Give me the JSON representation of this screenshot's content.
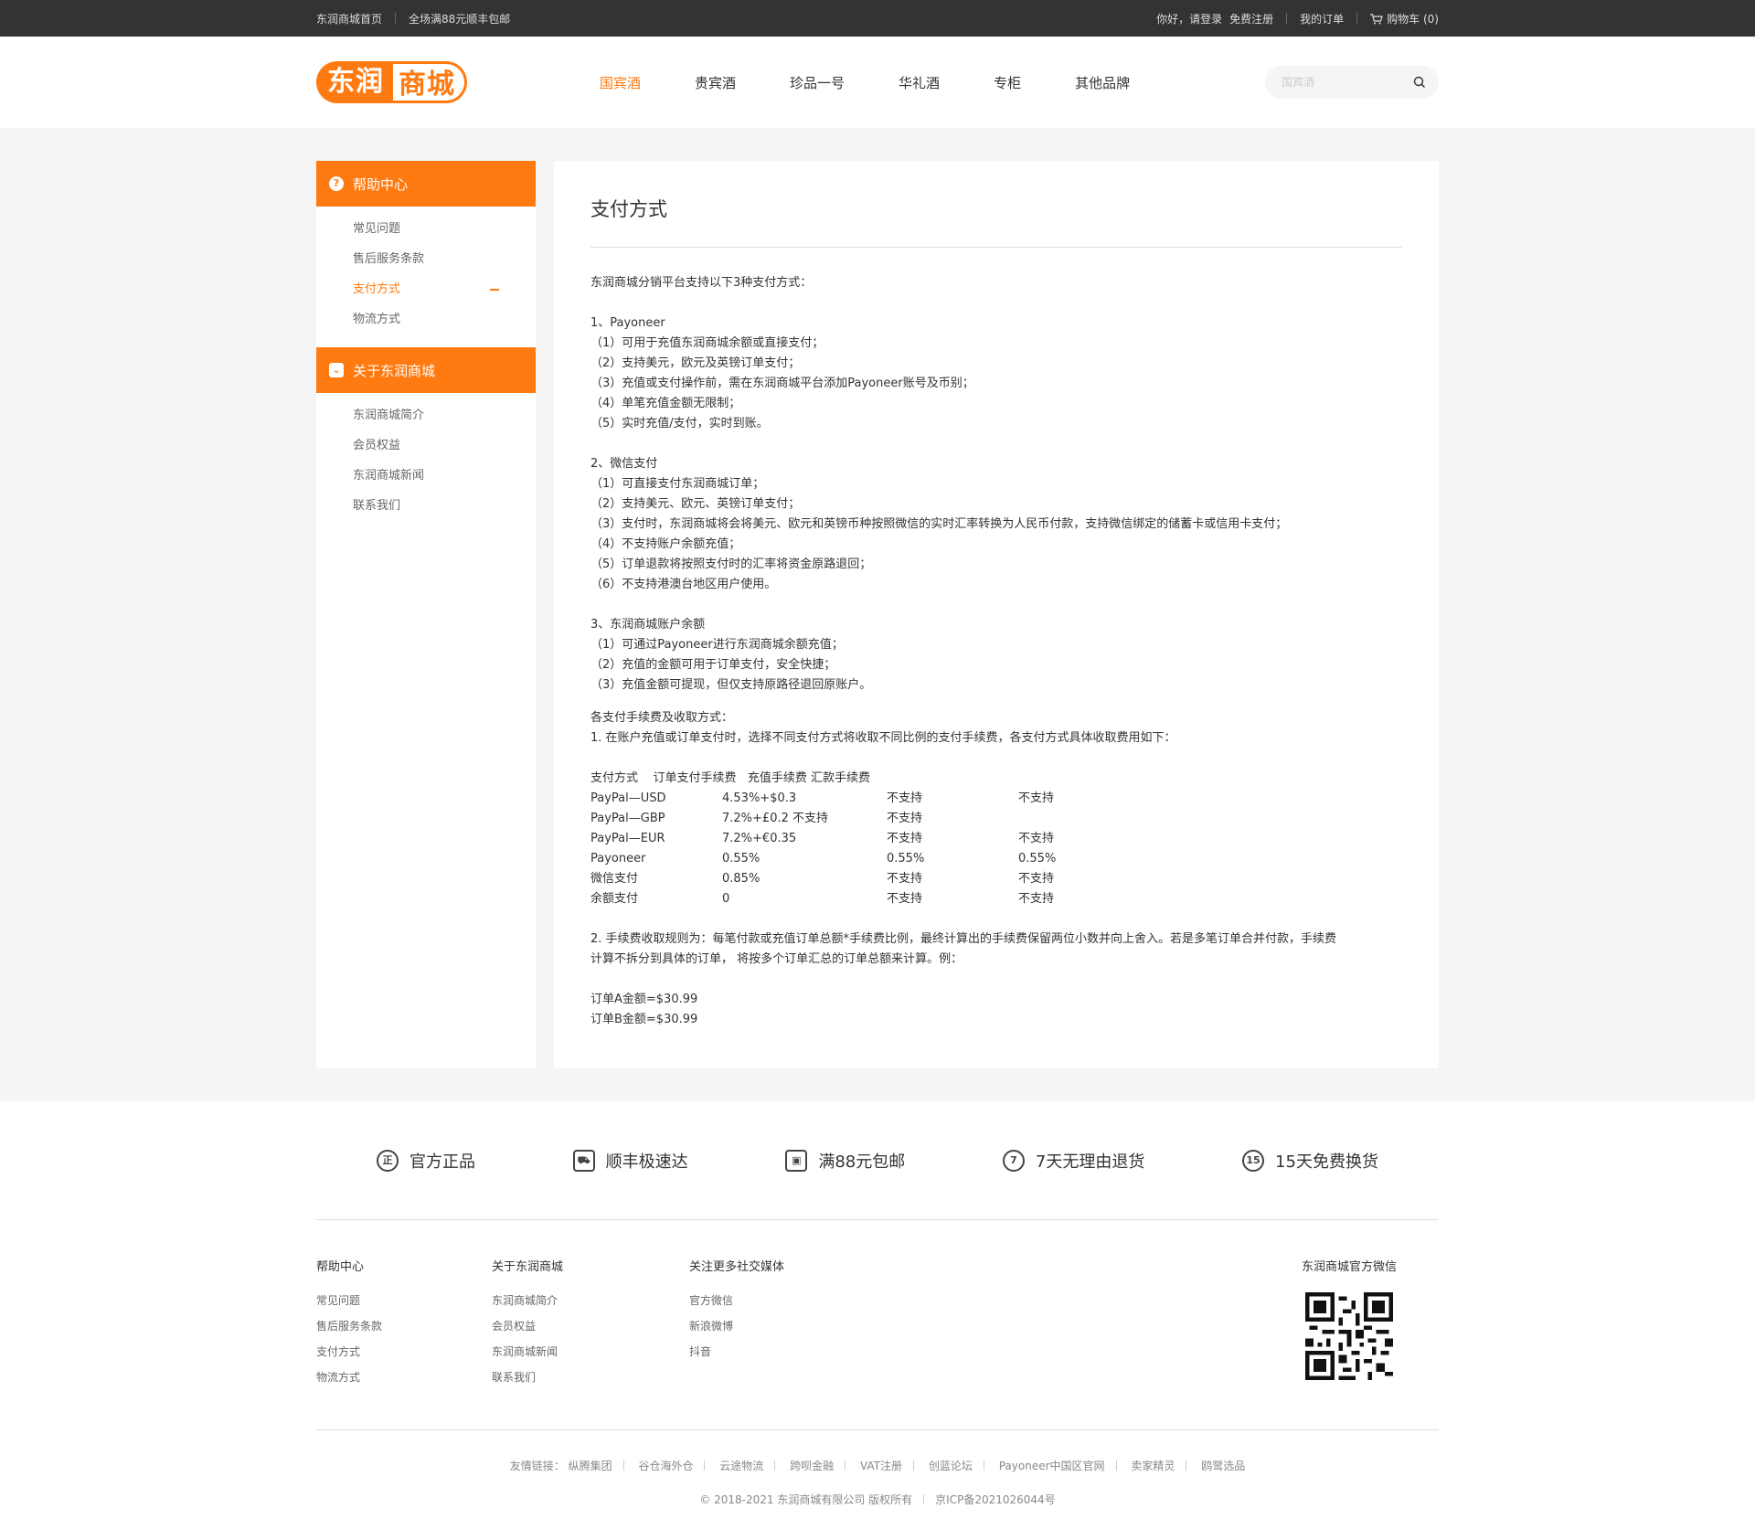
{
  "topbar": {
    "home": "东润商城首页",
    "shipping": "全场满88元顺丰包邮",
    "greeting": "你好，请登录",
    "register": "免费注册",
    "orders": "我的订单",
    "cart": "购物车 (0)"
  },
  "header": {
    "logo_a": "东润",
    "logo_b": "商城",
    "nav": [
      "国宾酒",
      "贵宾酒",
      "珍品一号",
      "华礼酒",
      "专柜",
      "其他品牌"
    ],
    "search_placeholder": "国宾酒"
  },
  "sidebar": {
    "help_title": "帮助中心",
    "help_items": [
      "常见问题",
      "售后服务条款",
      "支付方式",
      "物流方式"
    ],
    "about_title": "关于东润商城",
    "about_items": [
      "东润商城简介",
      "会员权益",
      "东润商城新闻",
      "联系我们"
    ]
  },
  "content": {
    "title": "支付方式",
    "intro": "东润商城分销平台支持以下3种支付方式：",
    "s1_title": "1、Payoneer",
    "s1": [
      "（1）可用于充值东润商城余额或直接支付；",
      "（2）支持美元，欧元及英镑订单支付；",
      "（3）充值或支付操作前，需在东润商城平台添加Payoneer账号及币别；",
      "（4）单笔充值金额无限制；",
      "（5）实时充值/支付，实时到账。"
    ],
    "s2_title": "2、微信支付",
    "s2": [
      "（1）可直接支付东润商城订单；",
      "（2）支持美元、欧元、英镑订单支付；",
      "（3）支付时，东润商城将会将美元、欧元和英镑币种按照微信的实时汇率转换为人民币付款，支持微信绑定的储蓄卡或信用卡支付；",
      "（4）不支持账户余额充值；",
      "（5）订单退款将按照支付时的汇率将资金原路退回；",
      "（6）不支持港澳台地区用户使用。"
    ],
    "s3_title": "3、东润商城账户余额",
    "s3": [
      "（1）可通过Payoneer进行东润商城余额充值；",
      "（2）充值的金额可用于订单支付，安全快捷；",
      "（3）充值金额可提现，但仅支持原路径退回原账户。"
    ],
    "fee_title": "各支付手续费及收取方式：",
    "fee_1": "1. 在账户充值或订单支付时，选择不同支付方式将收取不同比例的支付手续费，各支付方式具体收取费用如下：",
    "table_header": "支付方式    订单支付手续费   充值手续费 汇款手续费",
    "table_rows": [
      [
        "PayPal—USD",
        "4.53%+$0.3",
        "不支持",
        "不支持"
      ],
      [
        "PayPal—GBP",
        "7.2%+£0.2 不支持",
        "不支持",
        ""
      ],
      [
        "PayPal—EUR",
        "7.2%+€0.35",
        "不支持",
        "不支持"
      ],
      [
        "Payoneer",
        "0.55%",
        "0.55%",
        "0.55%"
      ],
      [
        "微信支付",
        "0.85%",
        "不支持",
        "不支持"
      ],
      [
        "余额支付",
        "0",
        "不支持",
        "不支持"
      ]
    ],
    "fee_2a": "2. 手续费收取规则为：每笔付款或充值订单总额*手续费比例，最终计算出的手续费保留两位小数并向上舍入。若是多笔订单合并付款，手续费",
    "fee_2b": "计算不拆分到具体的订单， 将按多个订单汇总的订单总额来计算。例：",
    "ex_a": "订单A金额=$30.99",
    "ex_b": "订单B金额=$30.99"
  },
  "features": [
    {
      "icon": "正",
      "label": "官方正品"
    },
    {
      "icon": "⛟",
      "label": "顺丰极速达"
    },
    {
      "icon": "▣",
      "label": "满88元包邮"
    },
    {
      "icon": "7",
      "label": "7天无理由退货"
    },
    {
      "icon": "15",
      "label": "15天免费换货"
    }
  ],
  "footer": {
    "col1_title": "帮助中心",
    "col1": [
      "常见问题",
      "售后服务条款",
      "支付方式",
      "物流方式"
    ],
    "col2_title": "关于东润商城",
    "col2": [
      "东润商城简介",
      "会员权益",
      "东润商城新闻",
      "联系我们"
    ],
    "col3_title": "关注更多社交媒体",
    "col3": [
      "官方微信",
      "新浪微博",
      "抖音"
    ],
    "qr_title": "东润商城官方微信",
    "friends_label": "友情链接：",
    "friends": [
      "纵腾集团",
      "谷仓海外仓",
      "云途物流",
      "跨呗金融",
      "VAT注册",
      "创蓝论坛",
      "Payoneer中国区官网",
      "卖家精灵",
      "鸥鹭选品"
    ],
    "copyright": "© 2018-2021 东润商城有限公司 版权所有",
    "icp": "京ICP备2021026044号"
  },
  "colors": {
    "accent": "#ff7a10",
    "topbar": "#333333",
    "page_bg": "#f5f5f5"
  }
}
